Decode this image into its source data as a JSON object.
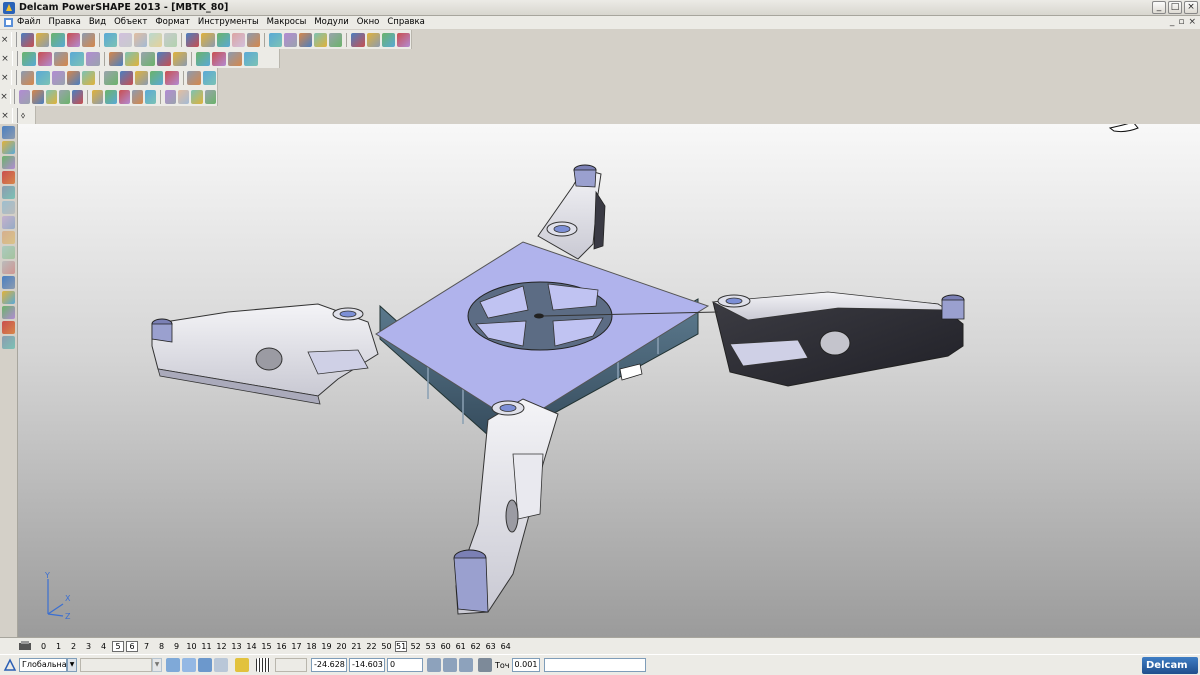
{
  "window": {
    "title": "Delcam PowerSHAPE 2013 - [MBTK_80]",
    "min_glyph": "_",
    "max_glyph": "□",
    "close_glyph": "×"
  },
  "menubar": {
    "items": [
      "Файл",
      "Правка",
      "Вид",
      "Объект",
      "Формат",
      "Инструменты",
      "Макросы",
      "Модули",
      "Окно",
      "Справка"
    ],
    "doc_min_glyph": "_",
    "doc_restore_glyph": "▫",
    "doc_close_glyph": "×"
  },
  "toolbars": {
    "close_glyph": "×",
    "row1": [
      "new-icon",
      "open-icon",
      "open-model-icon",
      "save-icon",
      "save-as-icon",
      "print-icon",
      "cut-icon",
      "copy-icon",
      "paste-icon",
      "delete-icon",
      "drawing-icon",
      "undo-icon",
      "redo-icon",
      "edit-text-icon",
      "wireframe-icon",
      "line-icon",
      "arc-icon",
      "circle-icon",
      "curve-icon",
      "surface-icon",
      "solid-icon",
      "assembly-icon",
      "tools-icon",
      "hammer-icon"
    ],
    "row2": [
      "view-top-icon",
      "view-front-icon",
      "view-right-icon",
      "view-iso-icon",
      "view-iso2-icon",
      "zoom-in-icon",
      "zoom-out-icon",
      "zoom-fit-icon",
      "zoom-box-icon",
      "rotate-icon",
      "shaded-icon",
      "wireframe-view-icon",
      "render-icon",
      "pan-icon"
    ],
    "row3": [
      "pin-icon",
      "doc-icon",
      "layers-icon",
      "shade-blue-icon",
      "shade-green-icon",
      "shade-red-icon",
      "cone-icon",
      "sphere-icon",
      "box-icon",
      "box2-icon",
      "cube-icon",
      "solid-blend-icon"
    ],
    "row4": [
      "pin-icon",
      "sphere-gray-icon",
      "axis-icon",
      "cylinder-icon",
      "block-icon",
      "extrude-icon",
      "revolve-icon",
      "sweep-icon",
      "boolean-icon",
      "fillet-icon",
      "chamfer-icon",
      "cut-icon",
      "shell-icon",
      "draft-icon"
    ],
    "row5_glyph": "⬨"
  },
  "lefttools": [
    "select-icon",
    "select-window-icon",
    "point-icon",
    "warning-icon",
    "arc-tool-icon",
    "align-icon",
    "mirror-icon",
    "scale-icon",
    "rotate-tool-icon",
    "move-icon",
    "offset-icon",
    "color-icon",
    "material-icon",
    "texture-icon",
    "render-tool-icon"
  ],
  "viewport": {
    "axis_labels": {
      "x": "X",
      "y": "Y",
      "z": "Z"
    }
  },
  "levels": {
    "values": [
      "0",
      "1",
      "2",
      "3",
      "4",
      "5",
      "6",
      "7",
      "8",
      "9",
      "10",
      "11",
      "12",
      "13",
      "14",
      "15",
      "16",
      "17",
      "18",
      "19",
      "20",
      "21",
      "22",
      "50",
      "51",
      "52",
      "53",
      "60",
      "61",
      "62",
      "63",
      "64"
    ],
    "active": [
      "5",
      "6",
      "51"
    ]
  },
  "status": {
    "workplane": "Глобальна",
    "coord_x": "-24.628",
    "coord_y": "-14.603",
    "coord_z": "0",
    "tolerance_label": "Точ",
    "tolerance": "0.001",
    "brand": "Delcam"
  }
}
